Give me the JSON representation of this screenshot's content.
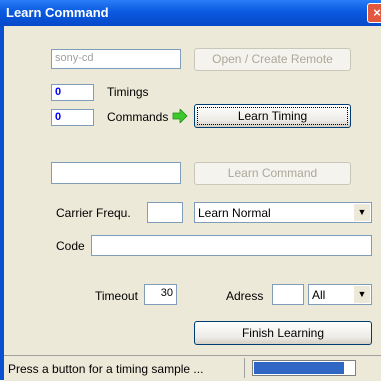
{
  "window": {
    "title": "Learn Command",
    "close_glyph": "×"
  },
  "remote": {
    "name_value": "sony-cd",
    "open_button": "Open / Create Remote"
  },
  "counters": {
    "timings_value": "0",
    "timings_label": "Timings",
    "commands_value": "0",
    "commands_label": "Commands",
    "arrow_icon": "green-arrow-right-icon"
  },
  "buttons": {
    "learn_timing": "Learn Timing",
    "learn_command": "Learn Command",
    "finish_learning": "Finish Learning"
  },
  "command": {
    "name_value": ""
  },
  "carrier": {
    "label": "Carrier Frequ.",
    "value": "",
    "mode_value": "Learn Normal"
  },
  "code": {
    "label": "Code",
    "value": ""
  },
  "timeout": {
    "label": "Timeout",
    "value": "30"
  },
  "address": {
    "label": "Adress",
    "value": "",
    "scope_value": "All"
  },
  "status": {
    "text": "Press a button for a timing sample ...",
    "progress_fraction": 0.9
  },
  "colors": {
    "titlebar": "#0a5ae0",
    "progress": "#3167c4",
    "arrow": "#3ccb2a"
  }
}
